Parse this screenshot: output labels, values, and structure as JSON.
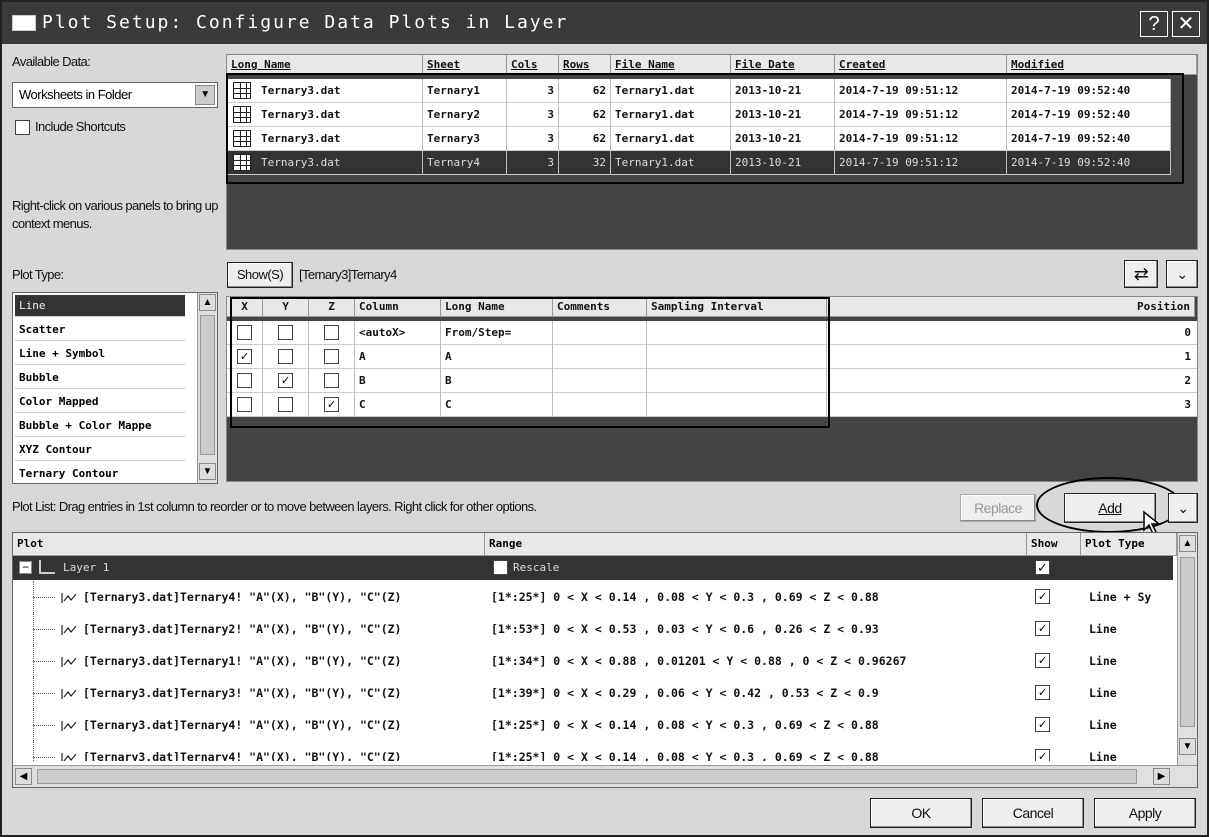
{
  "window": {
    "title": "Plot Setup: Configure Data Plots in Layer",
    "help": "?",
    "close": "✕"
  },
  "left": {
    "available_data_label": "Available Data:",
    "available_data_value": "Worksheets in Folder",
    "include_shortcuts_label": "Include Shortcuts",
    "hint": "Right-click on various panels to bring up context menus.",
    "plot_type_label": "Plot Type:",
    "plot_types": [
      "Line",
      "Scatter",
      "Line + Symbol",
      "Bubble",
      "Color Mapped",
      "Bubble + Color Mappe",
      "XYZ Contour",
      "Ternary Contour"
    ]
  },
  "data_table": {
    "headers": [
      "Long Name",
      "Sheet",
      "Cols",
      "Rows",
      "File Name",
      "File Date",
      "Created",
      "Modified"
    ],
    "rows": [
      [
        "Ternary3.dat",
        "Ternary1",
        "3",
        "62",
        "Ternary1.dat",
        "2013-10-21",
        "2014-7-19 09:51:12",
        "2014-7-19 09:52:40"
      ],
      [
        "Ternary3.dat",
        "Ternary2",
        "3",
        "62",
        "Ternary1.dat",
        "2013-10-21",
        "2014-7-19 09:51:12",
        "2014-7-19 09:52:40"
      ],
      [
        "Ternary3.dat",
        "Ternary3",
        "3",
        "62",
        "Ternary1.dat",
        "2013-10-21",
        "2014-7-19 09:51:12",
        "2014-7-19 09:52:40"
      ],
      [
        "Ternary3.dat",
        "Ternary4",
        "3",
        "32",
        "Ternary1.dat",
        "2013-10-21",
        "2014-7-19 09:51:12",
        "2014-7-19 09:52:40"
      ]
    ]
  },
  "show_bar": {
    "show_label": "Show(S)",
    "path": "[Ternary3]Ternary4"
  },
  "col_table": {
    "headers": [
      "X",
      "Y",
      "Z",
      "Column",
      "Long Name",
      "Comments",
      "Sampling Interval",
      "Position"
    ],
    "rows": [
      {
        "x": false,
        "y": false,
        "z": false,
        "column": "<autoX>",
        "long_name": "From/Step=",
        "position": "0"
      },
      {
        "x": true,
        "y": false,
        "z": false,
        "column": "A",
        "long_name": "A",
        "position": "1"
      },
      {
        "x": false,
        "y": true,
        "z": false,
        "column": "B",
        "long_name": "B",
        "position": "2"
      },
      {
        "x": false,
        "y": false,
        "z": true,
        "column": "C",
        "long_name": "C",
        "position": "3"
      }
    ]
  },
  "plot_list_label": "Plot List: Drag entries in 1st column to reorder or to move between layers. Right click for other options.",
  "buttons": {
    "replace": "Replace",
    "add": "Add",
    "ok": "OK",
    "cancel": "Cancel",
    "apply": "Apply"
  },
  "plot_list": {
    "headers": [
      "Plot",
      "Range",
      "Show",
      "Plot Type"
    ],
    "layer": {
      "name": "Layer 1",
      "range": "Rescale"
    },
    "rows": [
      {
        "plot": "[Ternary3.dat]Ternary4! \"A\"(X), \"B\"(Y), \"C\"(Z)",
        "range": "[1*:25*]  0 < X < 0.14 , 0.08 < Y < 0.3 , 0.69 < Z < 0.88",
        "type": "Line + Sy"
      },
      {
        "plot": "[Ternary3.dat]Ternary2! \"A\"(X), \"B\"(Y), \"C\"(Z)",
        "range": "[1*:53*]  0 < X < 0.53 , 0.03 < Y < 0.6 , 0.26 < Z < 0.93",
        "type": "Line"
      },
      {
        "plot": "[Ternary3.dat]Ternary1! \"A\"(X), \"B\"(Y), \"C\"(Z)",
        "range": "[1*:34*]  0 < X < 0.88 , 0.01201 < Y < 0.88 , 0 < Z < 0.96267",
        "type": "Line"
      },
      {
        "plot": "[Ternary3.dat]Ternary3! \"A\"(X), \"B\"(Y), \"C\"(Z)",
        "range": "[1*:39*]  0 < X < 0.29 , 0.06 < Y < 0.42 , 0.53 < Z < 0.9",
        "type": "Line"
      },
      {
        "plot": "[Ternary3.dat]Ternary4! \"A\"(X), \"B\"(Y), \"C\"(Z)",
        "range": "[1*:25*]  0 < X < 0.14 , 0.08 < Y < 0.3 , 0.69 < Z < 0.88",
        "type": "Line"
      },
      {
        "plot": "[Ternary3.dat]Ternary4! \"A\"(X), \"B\"(Y), \"C\"(Z)",
        "range": "[1*:25*]  0 < X < 0.14 , 0.08 < Y < 0.3 , 0.69 < Z < 0.88",
        "type": "Line"
      }
    ]
  }
}
